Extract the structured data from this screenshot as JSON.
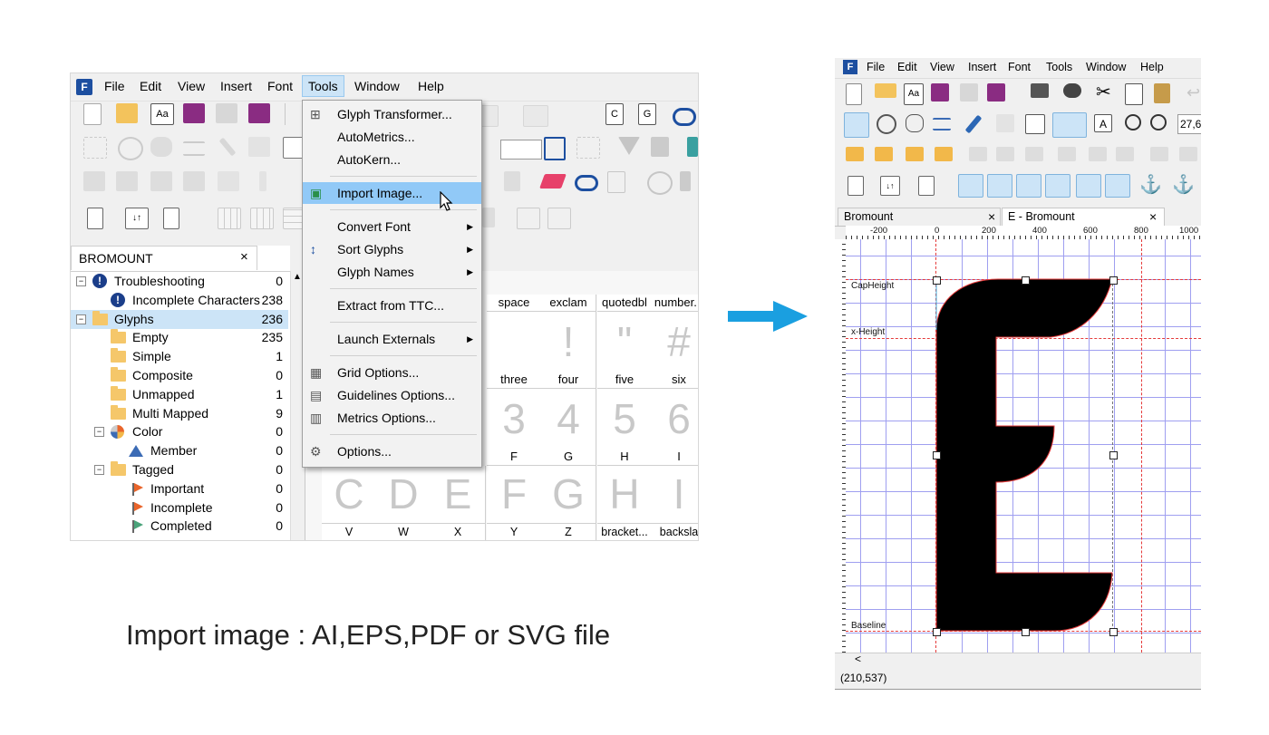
{
  "left_window": {
    "menubar": [
      "File",
      "Edit",
      "View",
      "Insert",
      "Font",
      "Tools",
      "Window",
      "Help"
    ],
    "active_menu": "Tools",
    "panel_title": "BROMOUNT",
    "panel_close": "×",
    "tree": [
      {
        "label": "Troubleshooting",
        "count": "0",
        "icon": "info-icon",
        "expander": "⊟"
      },
      {
        "label": "Incomplete Characters",
        "count": "238",
        "icon": "info-icon",
        "expander": ""
      },
      {
        "label": "Glyphs",
        "count": "236",
        "icon": "folder-icon",
        "expander": "⊟",
        "selected": true
      },
      {
        "label": "Empty",
        "count": "235",
        "icon": "folder-icon",
        "expander": ""
      },
      {
        "label": "Simple",
        "count": "1",
        "icon": "folder-icon",
        "expander": ""
      },
      {
        "label": "Composite",
        "count": "0",
        "icon": "folder-icon",
        "expander": ""
      },
      {
        "label": "Unmapped",
        "count": "1",
        "icon": "folder-icon",
        "expander": ""
      },
      {
        "label": "Multi Mapped",
        "count": "9",
        "icon": "folder-icon",
        "expander": ""
      },
      {
        "label": "Color",
        "count": "0",
        "icon": "color-wheel-icon",
        "expander": "⊟"
      },
      {
        "label": "Member",
        "count": "0",
        "icon": "triangle-icon",
        "expander": ""
      },
      {
        "label": "Tagged",
        "count": "0",
        "icon": "folder-icon",
        "expander": "⊟"
      },
      {
        "label": "Important",
        "count": "0",
        "icon": "flag-icon",
        "expander": ""
      },
      {
        "label": "Incomplete",
        "count": "0",
        "icon": "flag-icon",
        "expander": ""
      },
      {
        "label": "Completed",
        "count": "0",
        "icon": "flag-icon",
        "expander": ""
      }
    ],
    "tools_menu": [
      {
        "label": "Glyph Transformer...",
        "icon": "glyph-transformer-icon"
      },
      {
        "label": "AutoMetrics...",
        "icon": ""
      },
      {
        "label": "AutoKern...",
        "icon": ""
      },
      {
        "sep": true
      },
      {
        "label": "Import Image...",
        "icon": "import-image-icon",
        "highlight": true
      },
      {
        "sep": true
      },
      {
        "label": "Convert Font",
        "submenu": true
      },
      {
        "label": "Sort Glyphs",
        "submenu": true,
        "icon": "sort-icon"
      },
      {
        "label": "Glyph Names",
        "submenu": true
      },
      {
        "sep": true
      },
      {
        "label": "Extract from TTC..."
      },
      {
        "sep": true
      },
      {
        "label": "Launch Externals",
        "submenu": true
      },
      {
        "sep": true
      },
      {
        "label": "Grid Options...",
        "icon": "grid-icon"
      },
      {
        "label": "Guidelines Options...",
        "icon": "guidelines-icon"
      },
      {
        "label": "Metrics Options...",
        "icon": "metrics-icon"
      },
      {
        "sep": true
      },
      {
        "label": "Options...",
        "icon": "gear-icon"
      }
    ],
    "glyph_grid": {
      "row1_names": [
        "space",
        "exclam",
        "quotedbl",
        "number..."
      ],
      "row1_chars": [
        "",
        "!",
        "\"",
        "#"
      ],
      "row2_names": [
        "three",
        "four",
        "five",
        "six"
      ],
      "row2_chars": [
        "3",
        "4",
        "5",
        "6"
      ],
      "row3_names": [
        "F",
        "G",
        "H",
        "I"
      ],
      "row3_chars": [
        "C",
        "D",
        "E",
        "F",
        "G",
        "H",
        "I"
      ],
      "row4_names": [
        "V",
        "W",
        "X",
        "Y",
        "Z",
        "bracket...",
        "backsla"
      ]
    }
  },
  "caption": "Import image : AI,EPS,PDF or SVG file",
  "right_window": {
    "menubar": [
      "File",
      "Edit",
      "View",
      "Insert",
      "Font",
      "Tools",
      "Window",
      "Help"
    ],
    "zoom_value": "27,6",
    "tabs": [
      {
        "label": "Bromount",
        "close": "×"
      },
      {
        "label": "E - Bromount",
        "close": "×"
      }
    ],
    "ruler_ticks": [
      "-200",
      "0",
      "200",
      "400",
      "600",
      "800",
      "1000"
    ],
    "guides": [
      "CapHeight",
      "x-Height",
      "Baseline"
    ],
    "status": "(210,537)",
    "scroll_arrow": "<"
  },
  "colors": {
    "accent": "#1a9fe0",
    "menu_highlight": "#91c9f7",
    "guide_red": "#e53a3a",
    "grid_blue": "#9f9ff0",
    "glyph": "#000000"
  }
}
